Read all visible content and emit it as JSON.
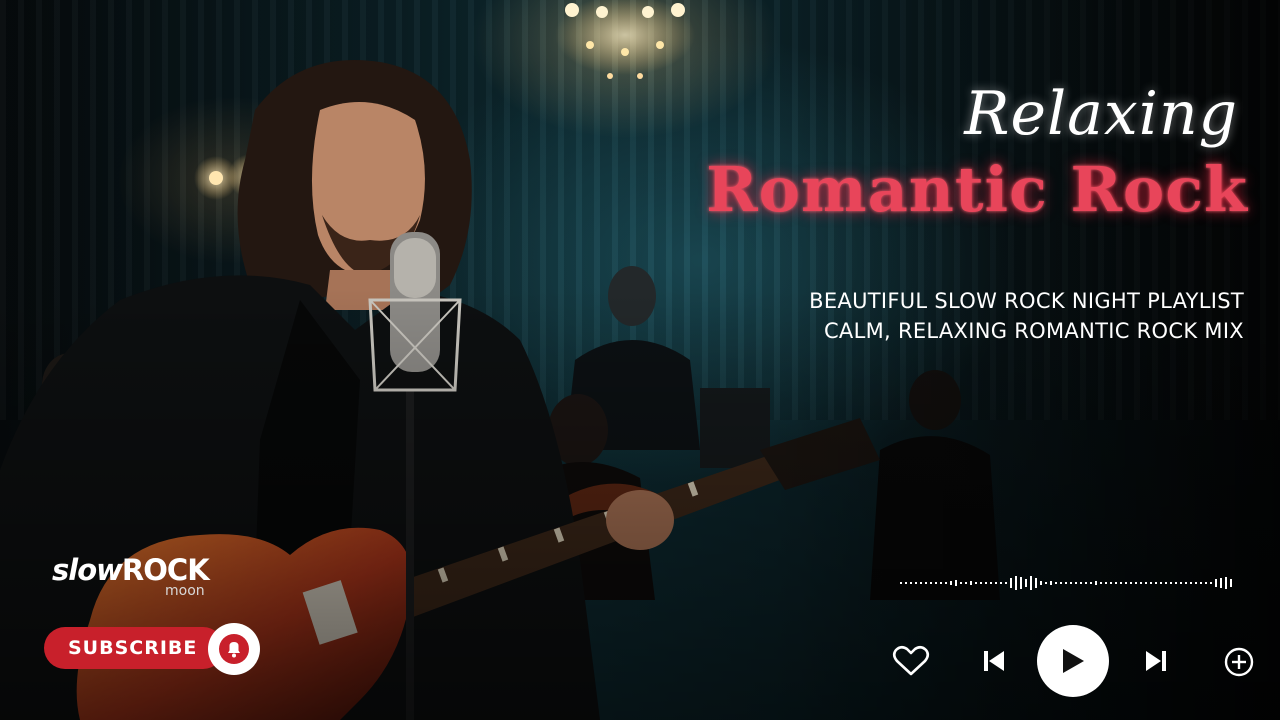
{
  "headline": {
    "line1": "Relaxing",
    "line2": "Romantic Rock"
  },
  "subtitle": {
    "line1": "BEAUTIFUL SLOW ROCK NIGHT PLAYLIST",
    "line2": "CALM, RELAXING ROMANTIC ROCK MIX"
  },
  "logo": {
    "prefix": "slow",
    "main": "ROCK",
    "sub": "moon"
  },
  "subscribe": {
    "label": "SUBSCRIBE"
  },
  "player": {
    "icons": [
      "heart-icon",
      "previous-icon",
      "play-icon",
      "next-icon",
      "add-icon"
    ]
  },
  "colors": {
    "accent_red": "#e8455a",
    "subscribe_red": "#c8202b"
  }
}
